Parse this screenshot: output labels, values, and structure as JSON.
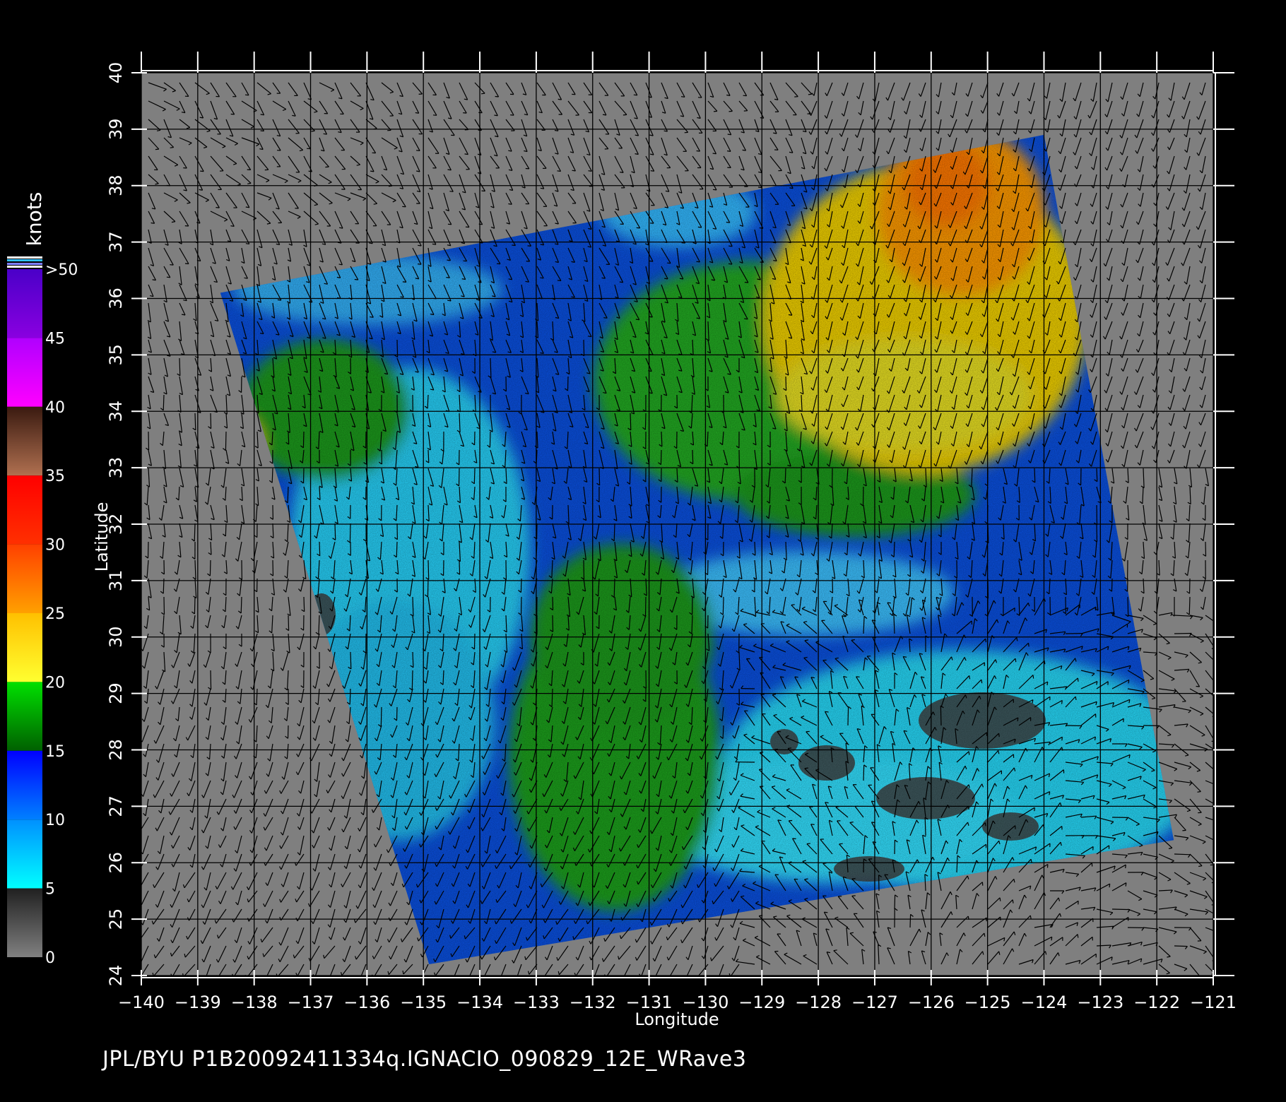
{
  "map": {
    "xlabel": "Longitude",
    "ylabel": "Latitude",
    "lon_range": [
      -140,
      -121
    ],
    "lat_range": [
      24,
      40
    ],
    "lon_ticks": [
      "−140",
      "−139",
      "−138",
      "−137",
      "−136",
      "−135",
      "−134",
      "−133",
      "−132",
      "−131",
      "−130",
      "−129",
      "−128",
      "−127",
      "−126",
      "−125",
      "−124",
      "−123",
      "−122",
      "−121"
    ],
    "lat_ticks": [
      "24",
      "25",
      "26",
      "27",
      "28",
      "29",
      "30",
      "31",
      "32",
      "33",
      "34",
      "35",
      "36",
      "37",
      "38",
      "39",
      "40"
    ],
    "grid": true,
    "background_color": "#7f7f7f",
    "swath_corners_lonlat": [
      [
        -138.6,
        36.1
      ],
      [
        -124.0,
        38.9
      ],
      [
        -121.7,
        26.4
      ],
      [
        -134.9,
        24.2
      ]
    ]
  },
  "colorbar": {
    "unit_label": "knots",
    "tick_labels": [
      ">50",
      "45",
      "40",
      "35",
      "30",
      "25",
      "20",
      "15",
      "10",
      "5",
      "0"
    ],
    "bands": [
      {
        "from": 45,
        "to": 50,
        "color_top": "#4a00c8",
        "color_bottom": "#8a00e0"
      },
      {
        "from": 40,
        "to": 45,
        "color_top": "#b000ff",
        "color_bottom": "#ff00ff"
      },
      {
        "from": 35,
        "to": 40,
        "color_top": "#3a1a10",
        "color_bottom": "#b07050"
      },
      {
        "from": 30,
        "to": 35,
        "color_top": "#ff0000",
        "color_bottom": "#ff3000"
      },
      {
        "from": 25,
        "to": 30,
        "color_top": "#ff4000",
        "color_bottom": "#ffa000"
      },
      {
        "from": 20,
        "to": 25,
        "color_top": "#ffc000",
        "color_bottom": "#ffff30"
      },
      {
        "from": 15,
        "to": 20,
        "color_top": "#00e000",
        "color_bottom": "#006000"
      },
      {
        "from": 10,
        "to": 15,
        "color_top": "#0000ff",
        "color_bottom": "#0080ff"
      },
      {
        "from": 5,
        "to": 10,
        "color_top": "#0090ff",
        "color_bottom": "#00ffff"
      },
      {
        "from": 0,
        "to": 5,
        "color_top": "#202020",
        "color_bottom": "#808080"
      }
    ]
  },
  "wind_field_regions": [
    {
      "name": "northeast-high-wind",
      "speed_knots": 22,
      "color": "#f0d000"
    },
    {
      "name": "northeast-peak",
      "speed_knots": 26,
      "color": "#ff9a00"
    },
    {
      "name": "central-green-band",
      "speed_knots": 17,
      "color": "#1aa01a"
    },
    {
      "name": "western-blue",
      "speed_knots": 12,
      "color": "#0a50e0"
    },
    {
      "name": "southeast-calm",
      "speed_knots": 7,
      "color": "#28d8f8"
    },
    {
      "name": "low-wind-patches",
      "speed_knots": 3,
      "color": "#404040"
    }
  ],
  "caption": "JPL/BYU  P1B20092411334q.IGNACIO_090829_12E_WRave3"
}
